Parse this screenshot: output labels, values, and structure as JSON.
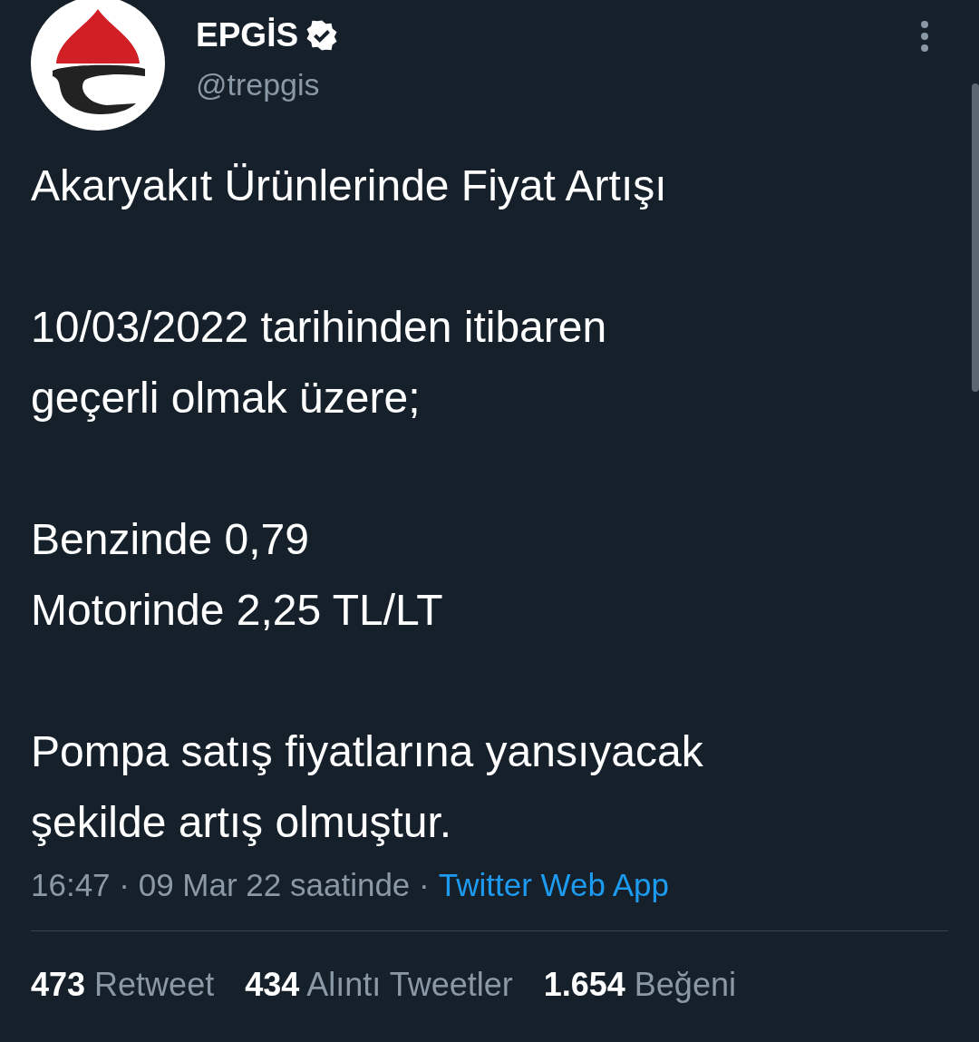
{
  "author": {
    "name": "EPGİS",
    "verified": true,
    "handle": "@trepgis"
  },
  "paragraphs": [
    "Akaryakıt Ürünlerinde Fiyat Artışı",
    "10/03/2022 tarihinden itibaren\ngeçerli olmak üzere;",
    "Benzinde 0,79\nMotorinde 2,25 TL/LT",
    "Pompa satış fiyatlarına yansıyacak\nşekilde artış olmuştur."
  ],
  "meta": {
    "text": "16:47 · 09 Mar 22 saatinde ·",
    "source": "Twitter Web App"
  },
  "stats": [
    {
      "count": "473",
      "label": "Retweet"
    },
    {
      "count": "434",
      "label": "Alıntı Tweetler"
    },
    {
      "count": "1.654",
      "label": "Beğeni"
    }
  ]
}
